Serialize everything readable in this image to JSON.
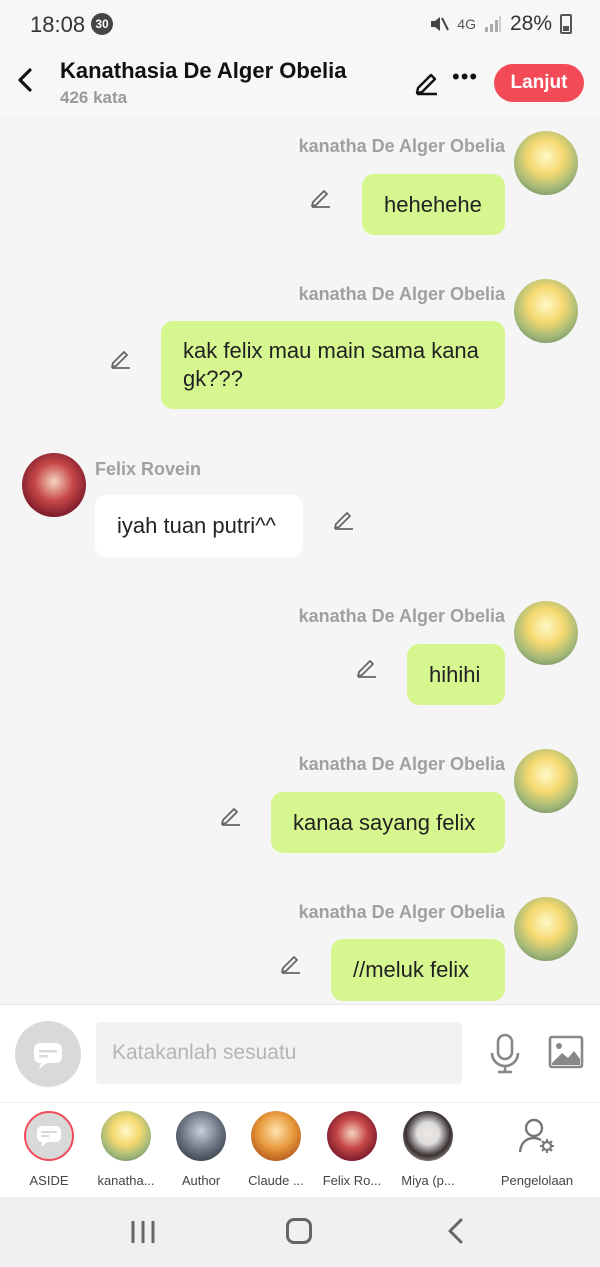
{
  "status_bar": {
    "time": "18:08",
    "notification_count": "30",
    "network": "4G",
    "battery": "28%"
  },
  "header": {
    "title": "Kanathasia De Alger Obelia",
    "subtitle": "426 kata",
    "next_button": "Lanjut"
  },
  "messages": [
    {
      "side": "right",
      "sender": "kanatha De Alger Obelia",
      "text": "hehehehe"
    },
    {
      "side": "right",
      "sender": "kanatha De Alger Obelia",
      "text": "kak felix mau main sama kana gk???"
    },
    {
      "side": "left",
      "sender": "Felix Rovein",
      "text": "iyah tuan putri^^"
    },
    {
      "side": "right",
      "sender": "kanatha De Alger Obelia",
      "text": "hihihi"
    },
    {
      "side": "right",
      "sender": "kanatha De Alger Obelia",
      "text": "kanaa sayang felix"
    },
    {
      "side": "right",
      "sender": "kanatha De Alger Obelia",
      "text": "//meluk felix"
    }
  ],
  "composer": {
    "placeholder": "Katakanlah sesuatu"
  },
  "characters": [
    {
      "name": "ASIDE"
    },
    {
      "name": "kanatha..."
    },
    {
      "name": "Author"
    },
    {
      "name": "Claude ..."
    },
    {
      "name": "Felix Ro..."
    },
    {
      "name": "Miya (p..."
    },
    {
      "name": "Pengelolaan"
    }
  ],
  "colors": {
    "accent": "#f24a57",
    "my_bubble": "#d6f690",
    "other_bubble": "#ffffff",
    "background": "#f5f5f5"
  }
}
